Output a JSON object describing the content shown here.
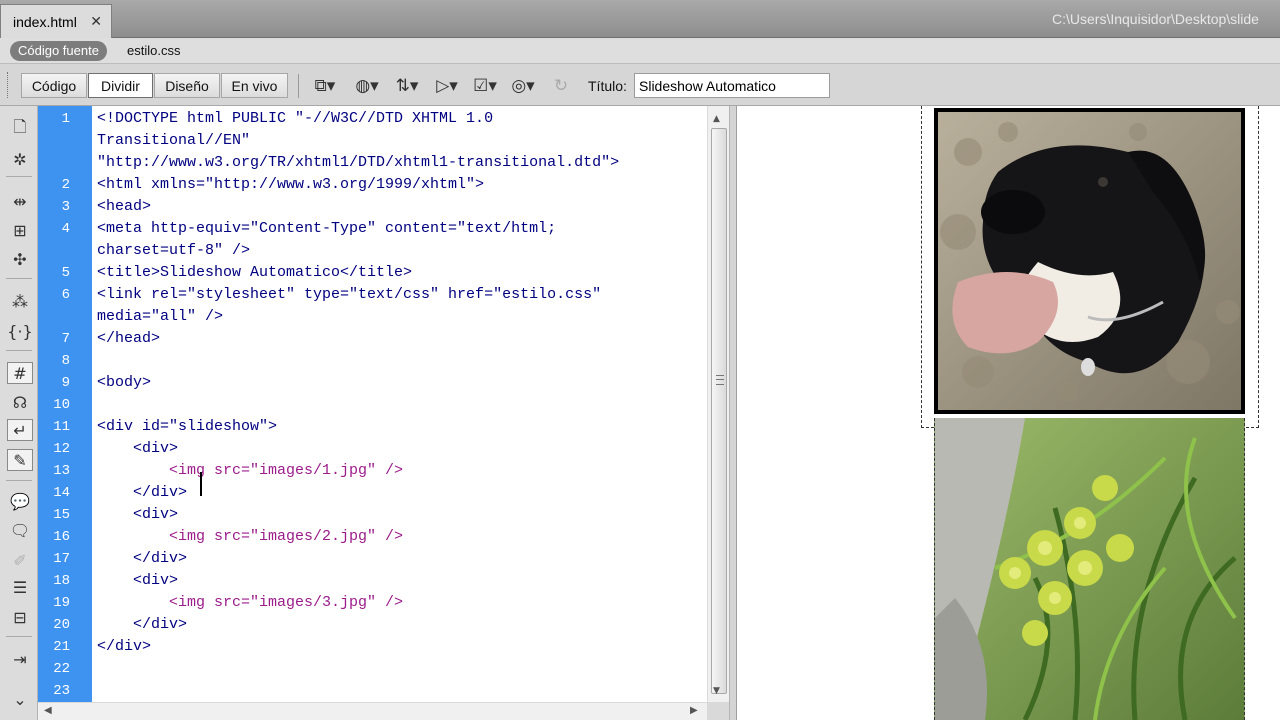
{
  "document_tab": {
    "label": "index.html",
    "close": "✕"
  },
  "file_path": "C:\\Users\\Inquisidor\\Desktop\\slide",
  "related_files": {
    "active": "Código fuente",
    "other": "estilo.css"
  },
  "toolbar": {
    "codigo": "Código",
    "dividir": "Dividir",
    "diseno": "Diseño",
    "en_vivo": "En vivo",
    "title_label": "Título:",
    "title_value": "Slideshow Automatico",
    "icons": [
      "multiscreen-icon",
      "preview-browser-icon",
      "file-management-icon",
      "inspect-icon",
      "validation-icon",
      "visual-aids-icon",
      "refresh-icon"
    ]
  },
  "code": {
    "line_numbers": [
      "1",
      "2",
      "3",
      "4",
      "5",
      "6",
      "7",
      "8",
      "9",
      "10",
      "11",
      "12",
      "13",
      "14",
      "15",
      "16",
      "17",
      "18",
      "19",
      "20",
      "21",
      "22",
      "23"
    ],
    "lines": [
      "<!DOCTYPE html PUBLIC \"-//W3C//DTD XHTML 1.0",
      "Transitional//EN\"",
      "\"http://www.w3.org/TR/xhtml1/DTD/xhtml1-transitional.dtd\">",
      "<html xmlns=\"http://www.w3.org/1999/xhtml\">",
      "<head>",
      "<meta http-equiv=\"Content-Type\" content=\"text/html;",
      "charset=utf-8\" />",
      "<title>Slideshow Automatico</title>",
      "<link rel=\"stylesheet\" type=\"text/css\" href=\"estilo.css\"",
      "media=\"all\" />",
      "</head>",
      "",
      "<body>",
      "",
      "<div id=\"slideshow\">",
      "    <div>",
      "        <img src=\"images/1.jpg\" />",
      "    </div>",
      "    <div>",
      "        <img src=\"images/2.jpg\" />",
      "    </div>",
      "    <div>",
      "        <img src=\"images/3.jpg\" />",
      "    </div>",
      "</div>",
      "",
      ""
    ]
  },
  "design_view": {
    "images": [
      "images/1.jpg",
      "images/2.jpg"
    ]
  }
}
